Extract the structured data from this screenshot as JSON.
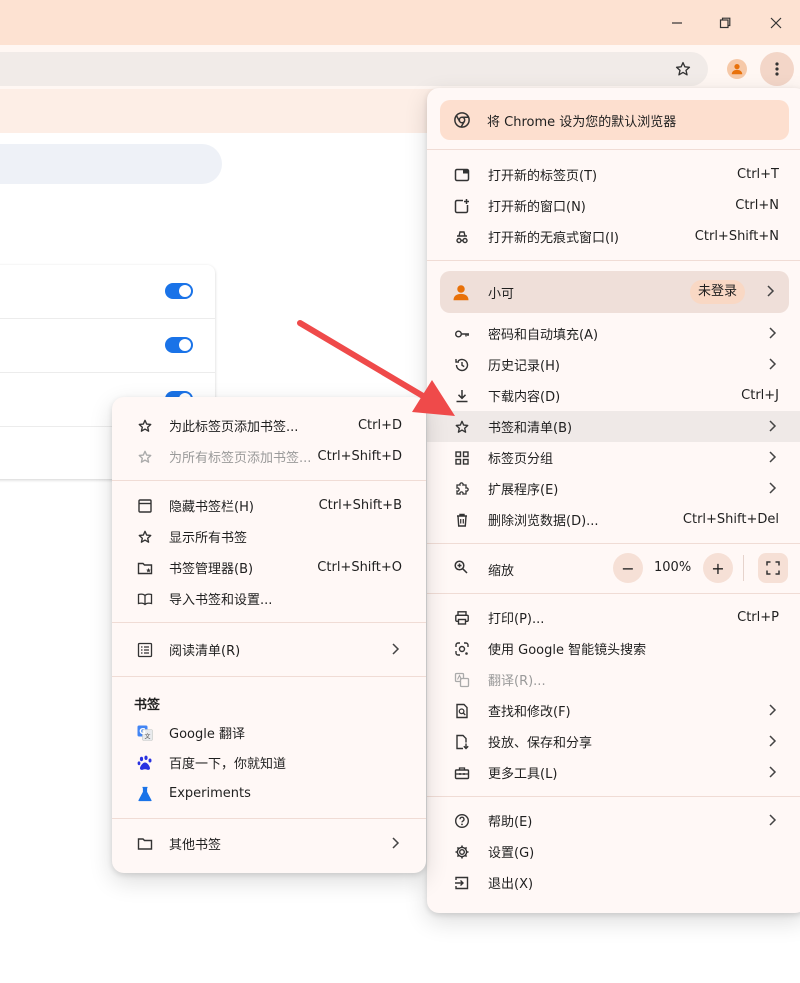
{
  "window": {
    "minimize_glyph": "─",
    "restore_glyph": "❐",
    "close_glyph": "✕"
  },
  "colors": {
    "accent": "#1a73e8",
    "brand_orange": "#e8710a",
    "arrow": "#ef4a4a",
    "titlebar": "#fde2d2"
  },
  "main_menu": {
    "promo": "将 Chrome 设为您的默认浏览器",
    "new_tab": {
      "label": "打开新的标签页(T)",
      "shortcut": "Ctrl+T"
    },
    "new_window": {
      "label": "打开新的窗口(N)",
      "shortcut": "Ctrl+N"
    },
    "incognito": {
      "label": "打开新的无痕式窗口(I)",
      "shortcut": "Ctrl+Shift+N"
    },
    "profile": {
      "name": "小可",
      "status": "未登录"
    },
    "passwords": {
      "label": "密码和自动填充(A)"
    },
    "history": {
      "label": "历史记录(H)"
    },
    "downloads": {
      "label": "下载内容(D)",
      "shortcut": "Ctrl+J"
    },
    "bookmarks": {
      "label": "书签和清单(B)"
    },
    "tab_groups": {
      "label": "标签页分组"
    },
    "extensions": {
      "label": "扩展程序(E)"
    },
    "clear_data": {
      "label": "删除浏览数据(D)...",
      "shortcut": "Ctrl+Shift+Del"
    },
    "zoom": {
      "label": "缩放",
      "minus": "−",
      "value": "100%",
      "plus": "+"
    },
    "print": {
      "label": "打印(P)...",
      "shortcut": "Ctrl+P"
    },
    "lens": {
      "label": "使用 Google 智能镜头搜索"
    },
    "translate": {
      "label": "翻译(R)..."
    },
    "find": {
      "label": "查找和修改(F)"
    },
    "cast": {
      "label": "投放、保存和分享"
    },
    "more_tools": {
      "label": "更多工具(L)"
    },
    "help": {
      "label": "帮助(E)"
    },
    "settings": {
      "label": "设置(G)"
    },
    "exit": {
      "label": "退出(X)"
    }
  },
  "bookmarks_menu": {
    "add_tab": {
      "label": "为此标签页添加书签...",
      "shortcut": "Ctrl+D"
    },
    "add_all": {
      "label": "为所有标签页添加书签...",
      "shortcut": "Ctrl+Shift+D"
    },
    "hide_bar": {
      "label": "隐藏书签栏(H)",
      "shortcut": "Ctrl+Shift+B"
    },
    "show_all": {
      "label": "显示所有书签"
    },
    "manager": {
      "label": "书签管理器(B)",
      "shortcut": "Ctrl+Shift+O"
    },
    "import": {
      "label": "导入书签和设置..."
    },
    "reading_list": {
      "label": "阅读清单(R)"
    },
    "section_title": "书签",
    "bookmark_items": [
      "Google 翻译",
      "百度一下，你就知道",
      "Experiments"
    ],
    "other": {
      "label": "其他书签"
    }
  }
}
